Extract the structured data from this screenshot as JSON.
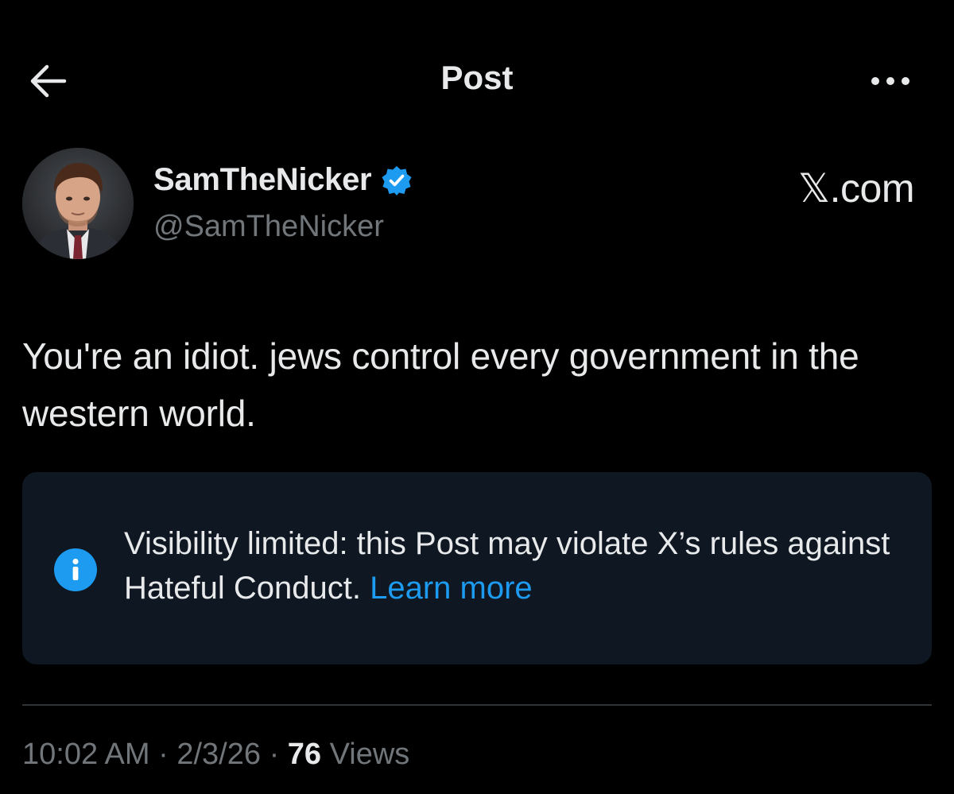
{
  "header": {
    "title": "Post",
    "back_icon": "arrow-left-icon",
    "more_icon": "more-horizontal-icon"
  },
  "author": {
    "display_name": "SamTheNicker",
    "handle": "@SamTheNicker",
    "verified_icon": "verified-badge-icon",
    "verified_color": "#1d9bf0"
  },
  "watermark": "𝕏.com",
  "post": {
    "text": "You're an idiot. jews control every government in the western world."
  },
  "notice": {
    "icon": "info-icon",
    "text": "Visibility limited: this Post may violate X’s rules against Hateful Conduct.",
    "link_label": "Learn more",
    "background": "#0f1722",
    "link_color": "#1d9bf0"
  },
  "meta": {
    "time": "10:02 AM",
    "separator": "·",
    "date": "2/3/26",
    "views_count": "76",
    "views_label": "Views"
  }
}
